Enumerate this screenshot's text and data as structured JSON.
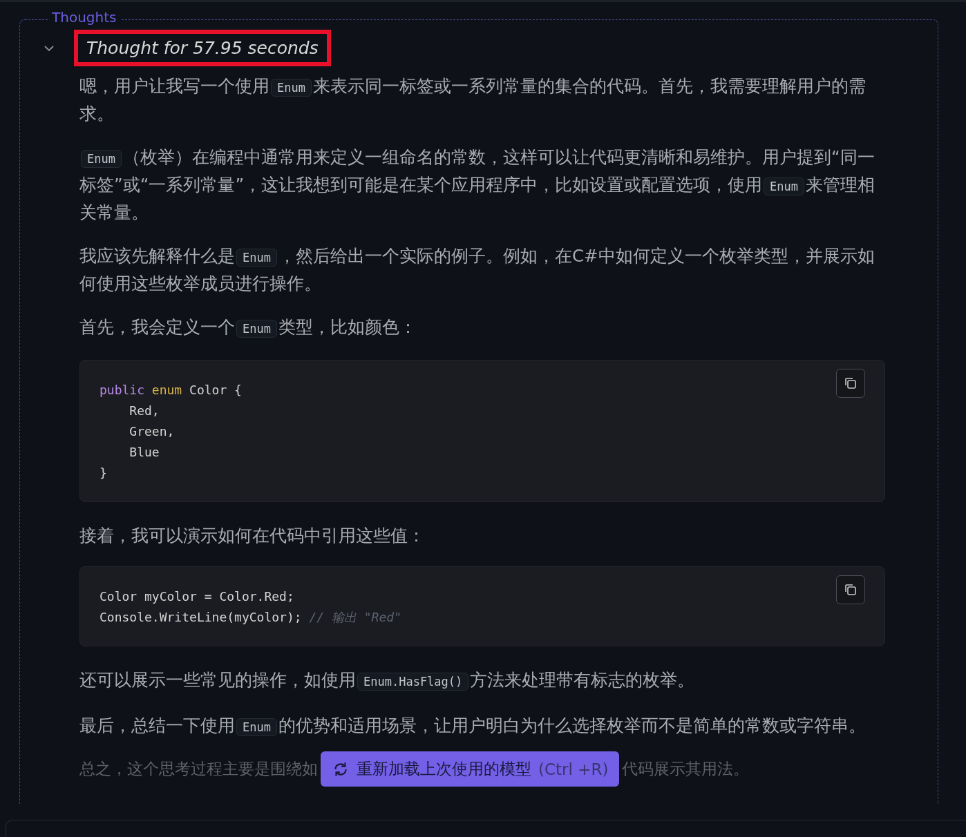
{
  "panel": {
    "legend": "Thoughts",
    "expanded": true,
    "summary": {
      "text": "Thought for 57.95 seconds",
      "highlighted": true
    }
  },
  "blocks": [
    {
      "kind": "para",
      "segments": [
        {
          "kind": "text",
          "text": "嗯，用户让我写一个使用"
        },
        {
          "kind": "code",
          "text": "Enum"
        },
        {
          "kind": "text",
          "text": "来表示同一标签或一系列常量的集合的代码。首先，我需要理解用户的需求。"
        }
      ]
    },
    {
      "kind": "para",
      "segments": [
        {
          "kind": "code",
          "text": "Enum"
        },
        {
          "kind": "text",
          "text": "（枚举）在编程中通常用来定义一组命名的常数，这样可以让代码更清晰和易维护。用户提到“同一标签”或“一系列常量”，这让我想到可能是在某个应用程序中，比如设置或配置选项，使用"
        },
        {
          "kind": "code",
          "text": "Enum"
        },
        {
          "kind": "text",
          "text": "来管理相关常量。"
        }
      ]
    },
    {
      "kind": "para",
      "segments": [
        {
          "kind": "text",
          "text": "我应该先解释什么是"
        },
        {
          "kind": "code",
          "text": "Enum"
        },
        {
          "kind": "text",
          "text": "，然后给出一个实际的例子。例如，在C#中如何定义一个枚举类型，并展示如何使用这些枚举成员进行操作。"
        }
      ]
    },
    {
      "kind": "para",
      "segments": [
        {
          "kind": "text",
          "text": "首先，我会定义一个"
        },
        {
          "kind": "code",
          "text": "Enum"
        },
        {
          "kind": "text",
          "text": "类型，比如颜色："
        }
      ]
    },
    {
      "kind": "codeblock",
      "lines": [
        [
          {
            "kind": "keyword",
            "text": "public"
          },
          {
            "kind": "type",
            "text": "enum"
          },
          {
            "kind": "plain",
            "text": " Color {"
          }
        ],
        [
          {
            "kind": "plain",
            "text": "    Red,"
          }
        ],
        [
          {
            "kind": "plain",
            "text": "    Green,"
          }
        ],
        [
          {
            "kind": "plain",
            "text": "    Blue"
          }
        ],
        [
          {
            "kind": "plain",
            "text": "}"
          }
        ]
      ]
    },
    {
      "kind": "para",
      "segments": [
        {
          "kind": "text",
          "text": "接着，我可以演示如何在代码中引用这些值："
        }
      ]
    },
    {
      "kind": "codeblock",
      "lines": [
        [
          {
            "kind": "plain",
            "text": "Color myColor = Color.Red;"
          }
        ],
        [
          {
            "kind": "plain",
            "text": "Console.WriteLine(myColor); "
          },
          {
            "kind": "comment",
            "text": "// 输出 \"Red\""
          }
        ]
      ]
    },
    {
      "kind": "para",
      "segments": [
        {
          "kind": "text",
          "text": "还可以展示一些常见的操作，如使用"
        },
        {
          "kind": "code",
          "text": "Enum.HasFlag()"
        },
        {
          "kind": "text",
          "text": "方法来处理带有标志的枚举。"
        }
      ]
    },
    {
      "kind": "para",
      "segments": [
        {
          "kind": "text",
          "text": "最后，总结一下使用"
        },
        {
          "kind": "code",
          "text": "Enum"
        },
        {
          "kind": "text",
          "text": "的优势和适用场景，让用户明白为什么选择枚举而不是简单的常数或字符串。"
        }
      ]
    }
  ],
  "last_line": {
    "before": "总之，这个思考过程主要是围绕如",
    "after": "代码展示其用法。"
  },
  "toast": {
    "label": "重新加载上次使用的模型",
    "shortcut": "(Ctrl +R)"
  }
}
